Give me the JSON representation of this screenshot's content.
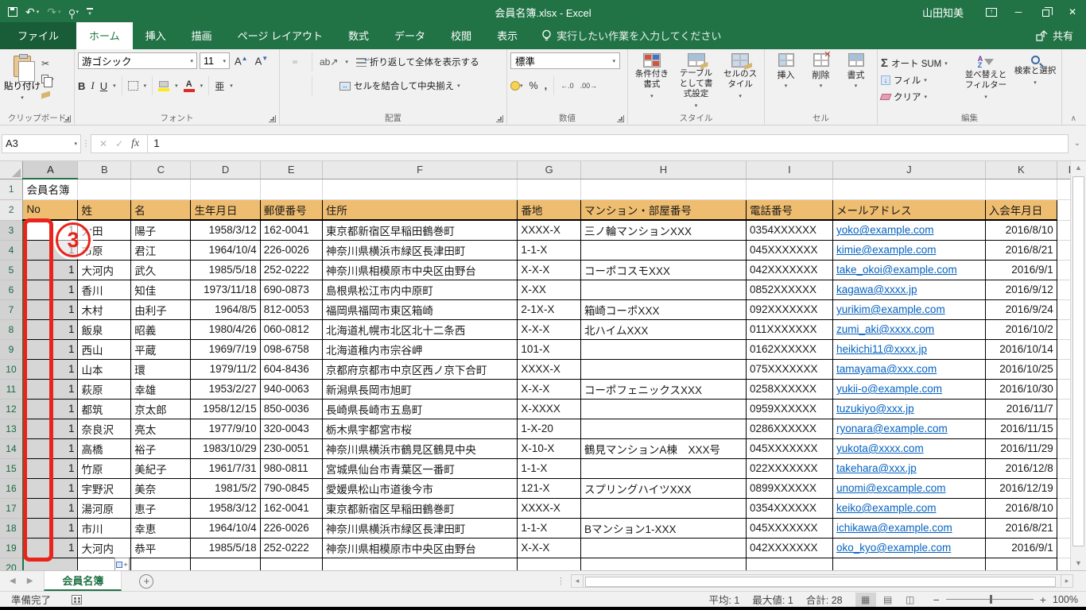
{
  "title_bar": {
    "title": "会員名簿.xlsx  -  Excel",
    "user_name": "山田知美"
  },
  "ribbon_tabs": [
    {
      "label": "ファイル",
      "type": "file",
      "active": false
    },
    {
      "label": "ホーム",
      "active": true
    },
    {
      "label": "挿入",
      "active": false
    },
    {
      "label": "描画",
      "active": false
    },
    {
      "label": "ページ レイアウト",
      "active": false
    },
    {
      "label": "数式",
      "active": false
    },
    {
      "label": "データ",
      "active": false
    },
    {
      "label": "校閲",
      "active": false
    },
    {
      "label": "表示",
      "active": false
    }
  ],
  "tell_me": "実行したい作業を入力してください",
  "share_label": "共有",
  "ribbon": {
    "clipboard": {
      "paste_label": "貼り付け",
      "group_label": "クリップボード"
    },
    "font": {
      "font_name": "游ゴシック",
      "font_size": "11",
      "bold": "B",
      "italic": "I",
      "underline": "U",
      "phonetic": "亜",
      "group_label": "フォント"
    },
    "alignment": {
      "wrap_label": "折り返して全体を表示する",
      "merge_label": "セルを結合して中央揃え",
      "group_label": "配置"
    },
    "number": {
      "format_name": "標準",
      "percent": "%",
      "comma": ",",
      "inc_decimal": "←.0",
      "dec_decimal": ".00→",
      "group_label": "数値"
    },
    "styles": {
      "conditional_label": "条件付き書式",
      "format_table_label": "テーブルとして書式設定",
      "cell_styles_label": "セルのスタイル",
      "group_label": "スタイル"
    },
    "cells": {
      "insert_label": "挿入",
      "delete_label": "削除",
      "format_label": "書式",
      "group_label": "セル"
    },
    "editing": {
      "autosum_label": "オート SUM",
      "fill_label": "フィル",
      "clear_label": "クリア",
      "sort_label": "並べ替えとフィルター",
      "find_label": "検索と選択",
      "group_label": "編集"
    }
  },
  "formula_bar": {
    "name_box": "A3",
    "formula": "1"
  },
  "sheet": {
    "column_letters": [
      "A",
      "B",
      "C",
      "D",
      "E",
      "F",
      "G",
      "H",
      "I",
      "J",
      "K",
      "L"
    ],
    "selected_column": "A",
    "active_cell": "A3",
    "title_cell": "会員名簿",
    "header_row": [
      "No",
      "姓",
      "名",
      "生年月日",
      "郵便番号",
      "住所",
      "番地",
      "マンション・部屋番号",
      "電話番号",
      "メールアドレス",
      "入会年月日"
    ],
    "rows": [
      {
        "row": 3,
        "no": "1",
        "last_name": "大田",
        "first_name": "陽子",
        "birth_date": "1958/3/12",
        "postal_code": "162-0041",
        "address": "東京都新宿区早稲田鶴巻町",
        "block": "XXXX-X",
        "apartment": "三ノ輪マンションXXX",
        "phone": "0354XXXXXX",
        "email": "yoko@example.com",
        "join_date": "2016/8/10"
      },
      {
        "row": 4,
        "no": "1",
        "last_name": "市原",
        "first_name": "君江",
        "birth_date": "1964/10/4",
        "postal_code": "226-0026",
        "address": "神奈川県横浜市緑区長津田町",
        "block": "1-1-X",
        "apartment": "",
        "phone": "045XXXXXXX",
        "email": "kimie@example.com",
        "join_date": "2016/8/21"
      },
      {
        "row": 5,
        "no": "1",
        "last_name": "大河内",
        "first_name": "武久",
        "birth_date": "1985/5/18",
        "postal_code": "252-0222",
        "address": "神奈川県相模原市中央区由野台",
        "block": "X-X-X",
        "apartment": "コーポコスモXXX",
        "phone": "042XXXXXXX",
        "email": "take_okoi@example.com",
        "join_date": "2016/9/1"
      },
      {
        "row": 6,
        "no": "1",
        "last_name": "香川",
        "first_name": "知佳",
        "birth_date": "1973/11/18",
        "postal_code": "690-0873",
        "address": "島根県松江市内中原町",
        "block": "X-XX",
        "apartment": "",
        "phone": "0852XXXXXX",
        "email": "kagawa@xxxx.jp",
        "join_date": "2016/9/12"
      },
      {
        "row": 7,
        "no": "1",
        "last_name": "木村",
        "first_name": "由利子",
        "birth_date": "1964/8/5",
        "postal_code": "812-0053",
        "address": "福岡県福岡市東区箱崎",
        "block": "2-1X-X",
        "apartment": "箱崎コーポXXX",
        "phone": "092XXXXXXX",
        "email": "yurikim@example.com",
        "join_date": "2016/9/24"
      },
      {
        "row": 8,
        "no": "1",
        "last_name": "飯泉",
        "first_name": "昭義",
        "birth_date": "1980/4/26",
        "postal_code": "060-0812",
        "address": "北海道札幌市北区北十二条西",
        "block": "X-X-X",
        "apartment": "北ハイムXXX",
        "phone": "011XXXXXXX",
        "email": "zumi_aki@xxxx.com",
        "join_date": "2016/10/2"
      },
      {
        "row": 9,
        "no": "1",
        "last_name": "西山",
        "first_name": "平蔵",
        "birth_date": "1969/7/19",
        "postal_code": "098-6758",
        "address": "北海道稚内市宗谷岬",
        "block": "101-X",
        "apartment": "",
        "phone": "0162XXXXXX",
        "email": "heikichi11@xxxx.jp",
        "join_date": "2016/10/14"
      },
      {
        "row": 10,
        "no": "1",
        "last_name": "山本",
        "first_name": "環",
        "birth_date": "1979/11/2",
        "postal_code": "604-8436",
        "address": "京都府京都市中京区西ノ京下合町",
        "block": "XXXX-X",
        "apartment": "",
        "phone": "075XXXXXXX",
        "email": "tamayama@xxx.com",
        "join_date": "2016/10/25"
      },
      {
        "row": 11,
        "no": "1",
        "last_name": "萩原",
        "first_name": "幸雄",
        "birth_date": "1953/2/27",
        "postal_code": "940-0063",
        "address": "新潟県長岡市旭町",
        "block": "X-X-X",
        "apartment": "コーポフェニックスXXX",
        "phone": "0258XXXXXX",
        "email": "yukii-o@example.com",
        "join_date": "2016/10/30"
      },
      {
        "row": 12,
        "no": "1",
        "last_name": "都筑",
        "first_name": "京太郎",
        "birth_date": "1958/12/15",
        "postal_code": "850-0036",
        "address": "長崎県長崎市五島町",
        "block": "X-XXXX",
        "apartment": "",
        "phone": "0959XXXXXX",
        "email": "tuzukiyo@xxx.jp",
        "join_date": "2016/11/7"
      },
      {
        "row": 13,
        "no": "1",
        "last_name": "奈良沢",
        "first_name": "亮太",
        "birth_date": "1977/9/10",
        "postal_code": "320-0043",
        "address": "栃木県宇都宮市桜",
        "block": "1-X-20",
        "apartment": "",
        "phone": "0286XXXXXX",
        "email": "ryonara@example.com",
        "join_date": "2016/11/15"
      },
      {
        "row": 14,
        "no": "1",
        "last_name": "高橋",
        "first_name": "裕子",
        "birth_date": "1983/10/29",
        "postal_code": "230-0051",
        "address": "神奈川県横浜市鶴見区鶴見中央",
        "block": "X-10-X",
        "apartment": "鶴見マンションA棟　XXX号",
        "phone": "045XXXXXXX",
        "email": "yukota@xxxx.com",
        "join_date": "2016/11/29"
      },
      {
        "row": 15,
        "no": "1",
        "last_name": "竹原",
        "first_name": "美紀子",
        "birth_date": "1961/7/31",
        "postal_code": "980-0811",
        "address": "宮城県仙台市青葉区一番町",
        "block": "1-1-X",
        "apartment": "",
        "phone": "022XXXXXXX",
        "email": "takehara@xxx.jp",
        "join_date": "2016/12/8"
      },
      {
        "row": 16,
        "no": "1",
        "last_name": "宇野沢",
        "first_name": "美奈",
        "birth_date": "1981/5/2",
        "postal_code": "790-0845",
        "address": "愛媛県松山市道後今市",
        "block": "121-X",
        "apartment": "スプリングハイツXXX",
        "phone": "0899XXXXXX",
        "email": "unomi@excample.com",
        "join_date": "2016/12/19"
      },
      {
        "row": 17,
        "no": "1",
        "last_name": "湯河原",
        "first_name": "恵子",
        "birth_date": "1958/3/12",
        "postal_code": "162-0041",
        "address": "東京都新宿区早稲田鶴巻町",
        "block": "XXXX-X",
        "apartment": "",
        "phone": "0354XXXXXX",
        "email": "keiko@example.com",
        "join_date": "2016/8/10"
      },
      {
        "row": 18,
        "no": "1",
        "last_name": "市川",
        "first_name": "幸恵",
        "birth_date": "1964/10/4",
        "postal_code": "226-0026",
        "address": "神奈川県横浜市緑区長津田町",
        "block": "1-1-X",
        "apartment": "Bマンション1-XXX",
        "phone": "045XXXXXXX",
        "email": "ichikawa@example.com",
        "join_date": "2016/8/21"
      },
      {
        "row": 19,
        "no": "1",
        "last_name": "大河内",
        "first_name": "恭平",
        "birth_date": "1985/5/18",
        "postal_code": "252-0222",
        "address": "神奈川県相模原市中央区由野台",
        "block": "X-X-X",
        "apartment": "",
        "phone": "042XXXXXXX",
        "email": "oko_kyo@example.com",
        "join_date": "2016/9/1"
      }
    ]
  },
  "annotation": {
    "badge": "3"
  },
  "sheet_tabs": {
    "active_tab": "会員名簿"
  },
  "status_bar": {
    "ready": "準備完了",
    "average": "平均: 1",
    "max": "最大値: 1",
    "sum": "合計: 28",
    "zoom_level": "100%"
  },
  "colors": {
    "excel_green": "#217346",
    "header_fill": "#efbd6f",
    "link_blue": "#0563c1",
    "annotation_red": "#e8241c",
    "selection_gray": "#d6d6d6"
  }
}
